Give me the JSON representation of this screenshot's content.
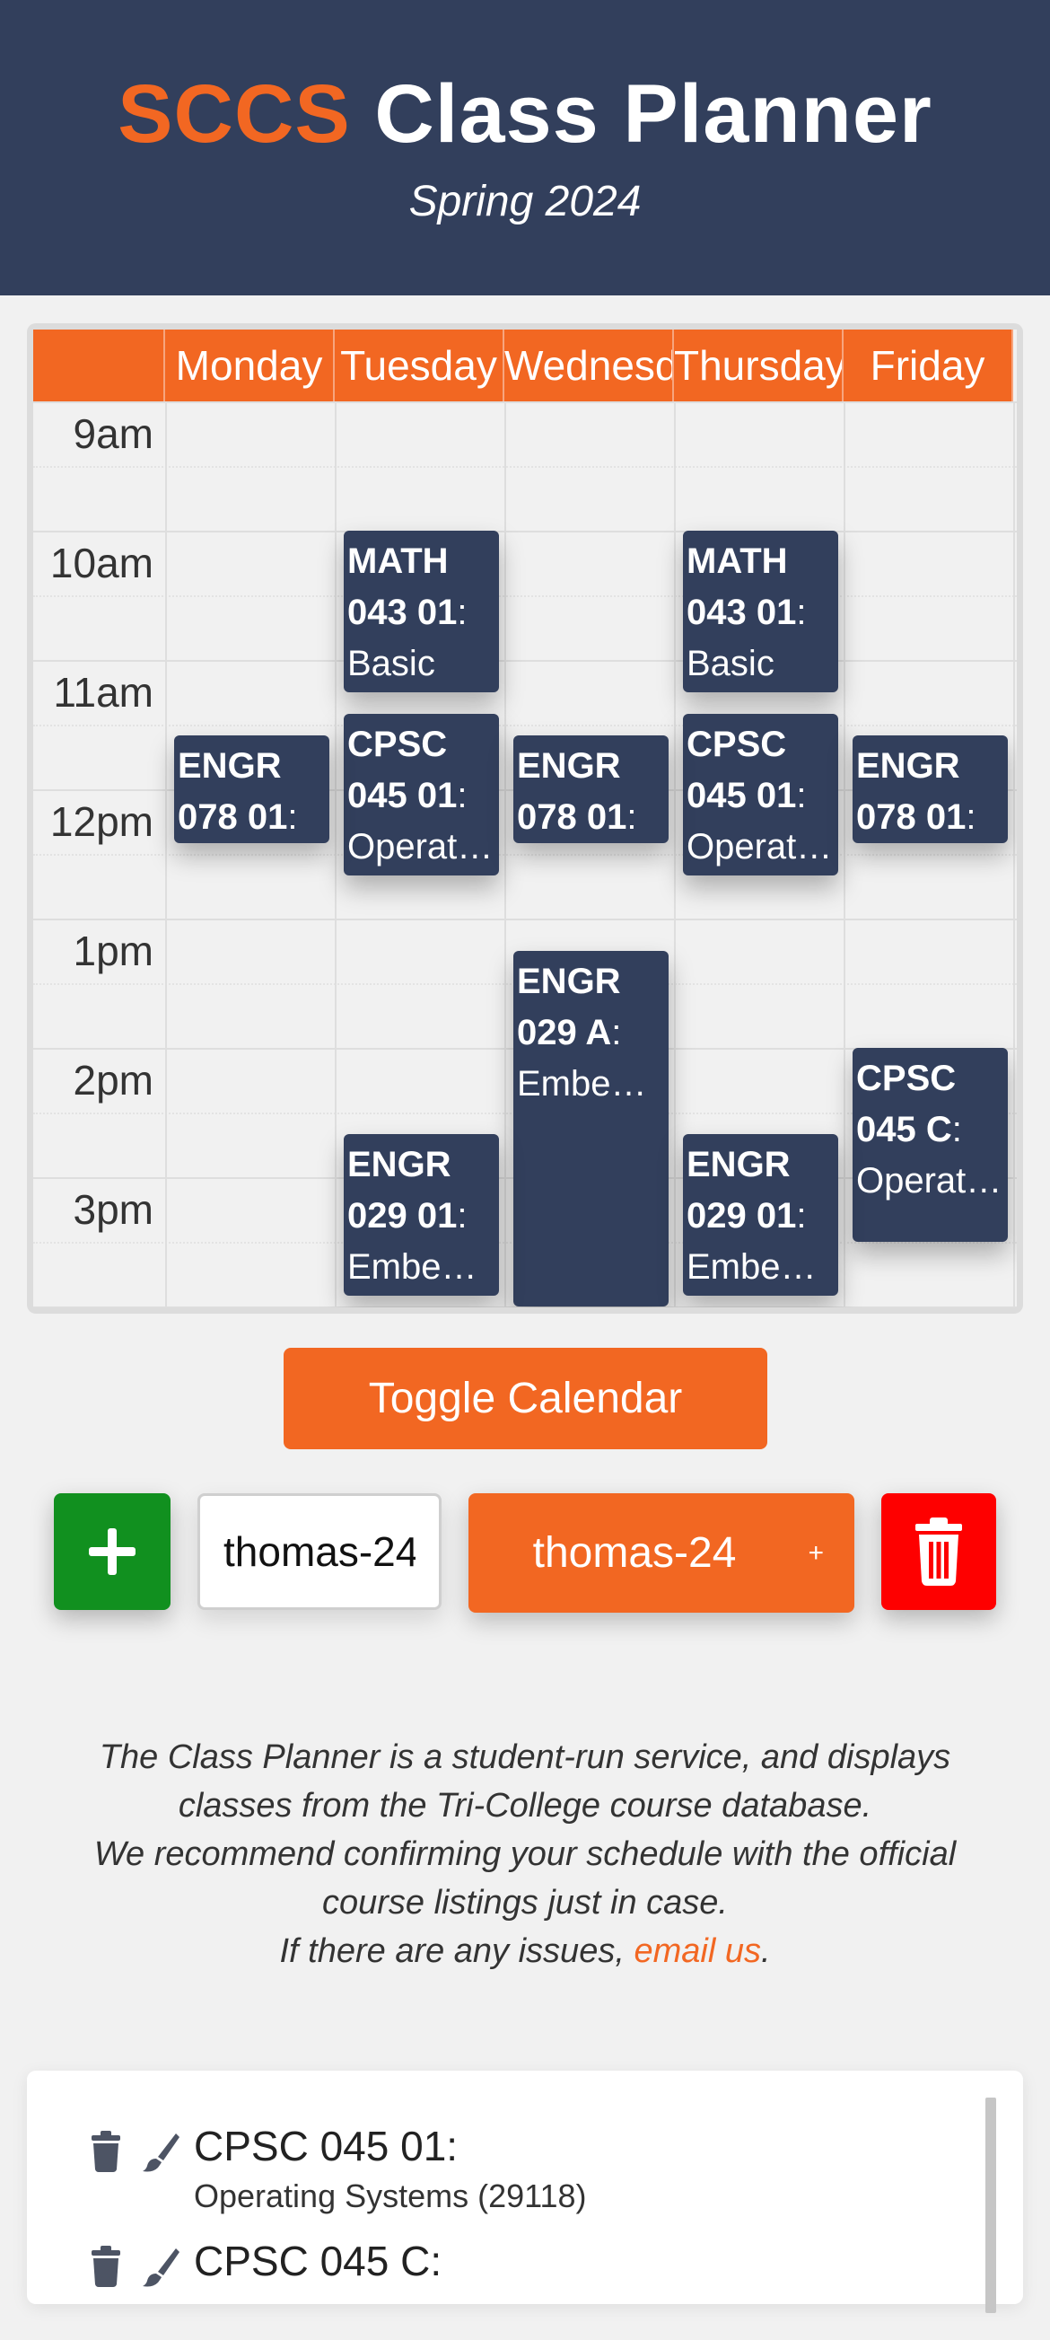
{
  "header": {
    "brand": "SCCS",
    "title": "Class Planner",
    "subtitle": "Spring 2024",
    "accent_color": "#f26722",
    "background_color": "#323f5c"
  },
  "calendar": {
    "days": [
      "Monday",
      "Tuesday",
      "Wednesday",
      "Thursday",
      "Friday"
    ],
    "times": [
      "9am",
      "10am",
      "11am",
      "12pm",
      "1pm",
      "2pm",
      "3pm"
    ],
    "events": [
      {
        "code": "MATH 043 01",
        "name": "Basic",
        "day": "Tuesday",
        "start": "10:00",
        "end": "11:15"
      },
      {
        "code": "MATH 043 01",
        "name": "Basic",
        "day": "Thursday",
        "start": "10:00",
        "end": "11:15"
      },
      {
        "code": "CPSC 045 01",
        "name": "Operating Systems",
        "day": "Tuesday",
        "start": "11:25",
        "end": "12:40"
      },
      {
        "code": "CPSC 045 01",
        "name": "Operating Systems",
        "day": "Thursday",
        "start": "11:25",
        "end": "12:40"
      },
      {
        "code": "ENGR 078 01",
        "name": "",
        "day": "Monday",
        "start": "11:35",
        "end": "12:25"
      },
      {
        "code": "ENGR 078 01",
        "name": "",
        "day": "Wednesday",
        "start": "11:35",
        "end": "12:25"
      },
      {
        "code": "ENGR 078 01",
        "name": "",
        "day": "Friday",
        "start": "11:35",
        "end": "12:25"
      },
      {
        "code": "ENGR 029 A",
        "name": "Embedded Systems",
        "day": "Wednesday",
        "start": "13:15",
        "end": "16:00"
      },
      {
        "code": "CPSC 045 C",
        "name": "Operating Systems",
        "day": "Friday",
        "start": "14:00",
        "end": "15:30"
      },
      {
        "code": "ENGR 029 01",
        "name": "Embedded Systems",
        "day": "Tuesday",
        "start": "14:40",
        "end": "15:55"
      },
      {
        "code": "ENGR 029 01",
        "name": "Embedded Systems",
        "day": "Thursday",
        "start": "14:40",
        "end": "15:55"
      }
    ]
  },
  "controls": {
    "toggle_label": "Toggle Calendar",
    "schedule_name_value": "thomas-24",
    "selected_schedule": "thomas-24",
    "select_plus": "+",
    "add_color": "#11901f",
    "delete_color": "#fe0000"
  },
  "footer": {
    "line1": "The Class Planner is a student-run service, and displays classes from the Tri-College course database.",
    "line2": "We recommend confirming your schedule with the official course listings just in case.",
    "line3_prefix": "If there are any issues, ",
    "link_text": "email us",
    "line3_suffix": "."
  },
  "course_list": [
    {
      "code": "CPSC 045 01:",
      "title": "Operating Systems (29118)"
    },
    {
      "code": "CPSC 045 C:",
      "title": ""
    }
  ]
}
